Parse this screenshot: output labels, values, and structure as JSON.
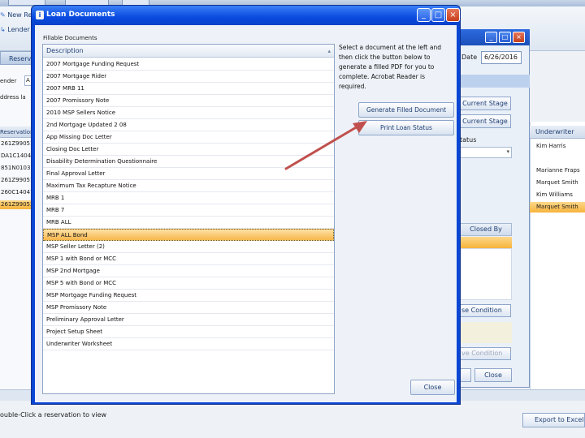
{
  "background_app": {
    "top_tabs": [
      "",
      "",
      ""
    ],
    "ribbon": {
      "new_reservation": "New Res",
      "lender": "Lender L"
    },
    "reservation_tab": "Reserv",
    "left_panel": {
      "lender_label": "ender",
      "lender_value": "A",
      "address_label": "ddress la",
      "reservation_header": "Reservation",
      "rows": [
        "261Z99051",
        "DA1C1404",
        "851N01037",
        "261Z99051",
        "260C14047",
        "261Z99053"
      ],
      "selected_index": 5
    },
    "second_window": {
      "date_label": "Date",
      "date_value": "6/26/2016",
      "current_stage_1": "Current Stage",
      "current_stage_2": "Current Stage",
      "status_label": "tatus",
      "closed_by_header": "Closed By",
      "close_condition": "se Condition",
      "remove_condition": "ve Condition",
      "close_button": "Close"
    },
    "underwriter_panel": {
      "header": "Underwriter",
      "rows": [
        "Kim Harris",
        "",
        "Marianne Fraps",
        "Marquet Smith",
        "Kim Williams",
        "Marquet Smith"
      ],
      "selected_index": 5
    },
    "hint": "ouble-Click a reservation to view",
    "export_button": "Export to Excel"
  },
  "dialog": {
    "title": "Loan Documents",
    "section_label": "Fillable Documents",
    "column_header": "Description",
    "documents": [
      "2007 Mortgage Funding Request",
      "2007 Mortgage Rider",
      "2007 MRB 11",
      "2007 Promissory Note",
      "2010 MSP Sellers Notice",
      "2nd Mortgage Updated 2 08",
      "App Missing Doc Letter",
      "Closing Doc Letter",
      "Disability Determination Questionnaire",
      "Final Approval Letter",
      "Maximum Tax Recapture Notice",
      "MRB 1",
      "MRB 7",
      "MRB ALL",
      "MSP ALL Bond",
      "MSP Seller Letter (2)",
      "MSP 1 with Bond or MCC",
      "MSP 2nd Mortgage",
      "MSP 5 with Bond or MCC",
      "MSP Mortgage Funding Request",
      "MSP Promissory Note",
      "Preliminary Approval Letter",
      "Project Setup Sheet",
      "Underwriter Worksheet"
    ],
    "selected_index": 14,
    "instructions": "Select a document at the left and then click the button below to generate a filled PDF for you to complete. Acrobat Reader is required.",
    "generate_button": "Generate Filled Document",
    "print_button": "Print Loan Status",
    "close_button": "Close"
  },
  "colors": {
    "titlebar": "#0a4ae0",
    "selection": "#f8b54a",
    "arrow": "#c0504d"
  }
}
